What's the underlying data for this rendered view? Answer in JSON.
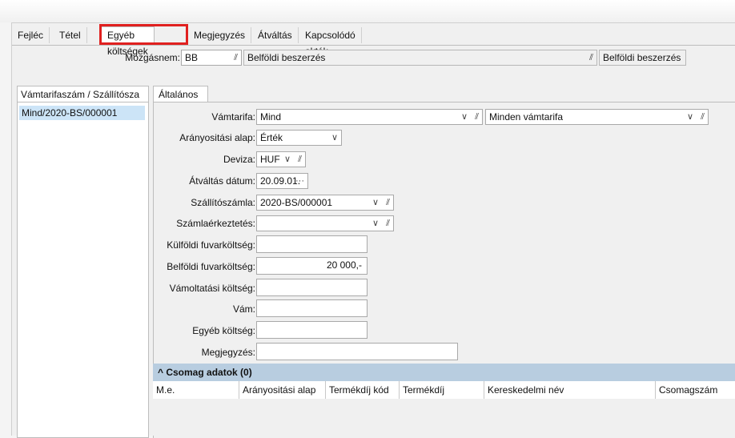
{
  "tabs": [
    "Fejléc",
    "Tétel",
    "Egyéb költségek",
    "Megjegyzés",
    "Átváltás",
    "Kapcsolódó akták"
  ],
  "active_tab_index": 2,
  "highlight_color": "#e0201f",
  "mozgasnem": {
    "label": "Mozgásnem:",
    "code": "BB",
    "description": "Belföldi beszerzés",
    "description2": "Belföldi beszerzés"
  },
  "left_panel": {
    "tab_label": "Vámtarifaszám / Szállítósza",
    "items": [
      "Mind/2020-BS/000001"
    ]
  },
  "right_panel": {
    "tab_label": "Általános",
    "fields": {
      "vamtarifa": {
        "label": "Vámtarifa:",
        "value": "Mind",
        "value2": "Minden vámtarifa"
      },
      "aranyositasi_alap": {
        "label": "Arányositási alap:",
        "value": "Érték"
      },
      "deviza": {
        "label": "Deviza:",
        "value": "HUF"
      },
      "atvaltas_datum": {
        "label": "Átváltás dátum:",
        "value": "20.09.01.",
        "button": "···"
      },
      "szallitoszamla": {
        "label": "Szállítószámla:",
        "value": "2020-BS/000001"
      },
      "szamlaerkeztetes": {
        "label": "Számlaérkeztetés:",
        "value": ""
      },
      "kulfoldi_fuvarkoltseg": {
        "label": "Külföldi fuvarköltség:",
        "value": ""
      },
      "belfoldi_fuvarkoltseg": {
        "label": "Belföldi fuvarköltség:",
        "value": "20 000,-"
      },
      "vamoltatasi_koltseg": {
        "label": "Vámoltatási költség:",
        "value": ""
      },
      "vam": {
        "label": "Vám:",
        "value": ""
      },
      "egyeb_koltseg": {
        "label": "Egyéb költség:",
        "value": ""
      },
      "megjegyzes": {
        "label": "Megjegyzés:",
        "value": ""
      }
    }
  },
  "csomag": {
    "title": "^ Csomag adatok (0)",
    "columns": [
      "M.e.",
      "Arányositási alap",
      "Termékdíj kód",
      "Termékdíj",
      "Kereskedelmi név",
      "Csomagszám"
    ]
  },
  "icons": {
    "clip": "paperclip-icon",
    "chevron": "chevron-down-icon"
  },
  "glyphs": {
    "clip": "⫽",
    "chevron": "∨"
  }
}
